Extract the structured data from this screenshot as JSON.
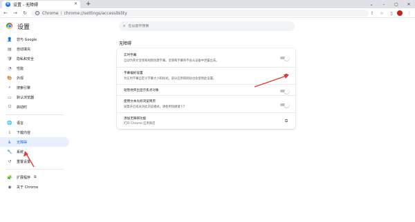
{
  "browser": {
    "tab": {
      "favicon": "gear-icon",
      "title": "设置 - 无障碍",
      "close": "✕"
    },
    "new_tab": "+",
    "window": {
      "minimize": "–",
      "maximize": "▢",
      "close": "✕"
    },
    "toolbar": {
      "back": "←",
      "forward": "→",
      "reload": "↻",
      "site_label": "Chrome",
      "separator": "|",
      "url": "chrome://settings/accessibility",
      "share_icon": "share-icon",
      "bookmark_icon": "star-icon",
      "menu_icon": "⋮"
    }
  },
  "settings": {
    "title": "设置",
    "search_placeholder": "在设置中搜索"
  },
  "sidebar": {
    "items": [
      {
        "label": "您与 Google",
        "icon": "person-icon",
        "glyph": "👤"
      },
      {
        "label": "自动填充",
        "icon": "autofill-icon",
        "glyph": "▤"
      },
      {
        "label": "隐私和安全",
        "icon": "shield-icon",
        "glyph": "🛡"
      },
      {
        "label": "性能",
        "icon": "performance-icon",
        "glyph": "◔"
      },
      {
        "label": "外观",
        "icon": "palette-icon",
        "glyph": "🎨"
      },
      {
        "label": "搜索引擎",
        "icon": "search-icon",
        "glyph": "⌕"
      },
      {
        "label": "默认浏览器",
        "icon": "browser-icon",
        "glyph": "▭"
      },
      {
        "label": "启动时",
        "icon": "power-icon",
        "glyph": "⏻"
      },
      {
        "label": "语言",
        "icon": "globe-icon",
        "glyph": "🌐"
      },
      {
        "label": "下载内容",
        "icon": "download-icon",
        "glyph": "⤓"
      },
      {
        "label": "无障碍",
        "icon": "accessibility-icon",
        "glyph": "♿"
      },
      {
        "label": "系统",
        "icon": "wrench-icon",
        "glyph": "🔧"
      },
      {
        "label": "重置设置",
        "icon": "reset-icon",
        "glyph": "↺"
      },
      {
        "label": "扩展程序",
        "icon": "puzzle-icon",
        "glyph": "🧩",
        "ext": "⧉"
      },
      {
        "label": "关于 Chrome",
        "icon": "chrome-icon",
        "glyph": "◉"
      }
    ],
    "active_index": 10
  },
  "main": {
    "section_title": "无障碍",
    "rows": [
      {
        "title": "实时字幕",
        "desc": "自动为英文音频和视频创建字幕。音频和字幕将不会从设备中泄露出去。",
        "control": "toggle",
        "on": false
      },
      {
        "title": "字幕偏好设置",
        "desc": "为实时字幕自定义字幕大小和样式。部分应用和网站也会使用此设置。",
        "control": "external-link"
      },
      {
        "title": "短暂地突出显示焦点对象",
        "desc": "",
        "control": "toggle",
        "on": false
      },
      {
        "title": "使用文本光标浏览网页",
        "desc": "如需开启或关闭此浏览模式，请使用快捷键 F7",
        "control": "toggle",
        "on": false
      },
      {
        "title": "添加无障碍功能",
        "desc": "打开 Chrome 应用商店",
        "control": "external-link"
      }
    ]
  },
  "colors": {
    "accent": "#1a73e8",
    "active_bg": "#e8f0fe",
    "annotation": "#e53935"
  }
}
